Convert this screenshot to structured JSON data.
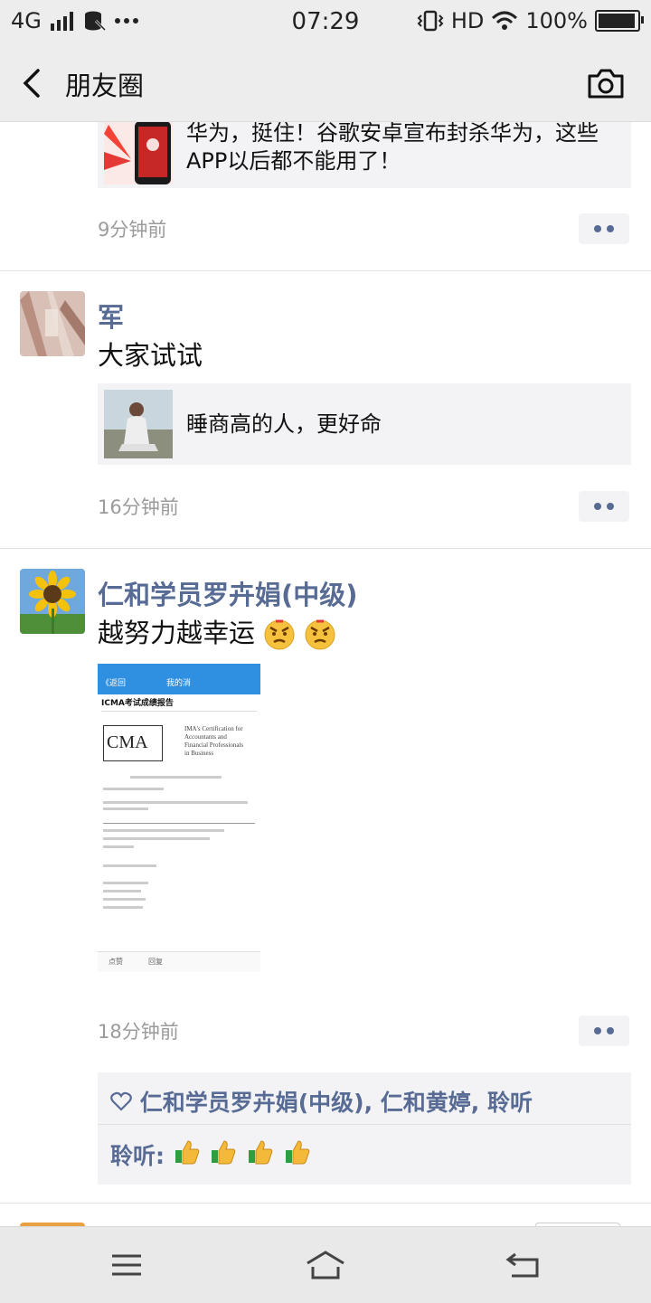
{
  "status_bar": {
    "network": "4G",
    "time": "07:29",
    "hd": "HD",
    "battery": "100%"
  },
  "nav": {
    "title": "朋友圈"
  },
  "posts": [
    {
      "link_title": "华为，挺住！谷歌安卓宣布封杀华为，这些APP以后都不能用了！",
      "time": "9分钟前"
    },
    {
      "name": "军",
      "text": "大家试试",
      "link_title": "睡商高的人，更好命",
      "time": "16分钟前"
    },
    {
      "name": "仁和学员罗卉娟(中级)",
      "text": "越努力越幸运",
      "time": "18分钟前",
      "screenshot": {
        "nav_back": "《返回",
        "nav_title": "我的消",
        "heading": "ICMA考试成绩报告",
        "cma_logo": "CMA",
        "cert_lines": [
          "IMA's Certification for",
          "Accountants and",
          "Financial Professionals",
          "in Business"
        ],
        "footer_like": "点赞",
        "footer_reply": "回复"
      },
      "likes": {
        "names": "仁和学员罗卉娟(中级), 仁和黄婷, 聆听"
      },
      "comment": {
        "author": "聆听:"
      }
    }
  ],
  "icons": {
    "back": "chevron-left-icon",
    "camera": "camera-icon",
    "menu": "menu-icon",
    "home": "home-icon",
    "return": "return-icon"
  },
  "colors": {
    "link": "#576b95",
    "nav_bg": "#ededed"
  }
}
